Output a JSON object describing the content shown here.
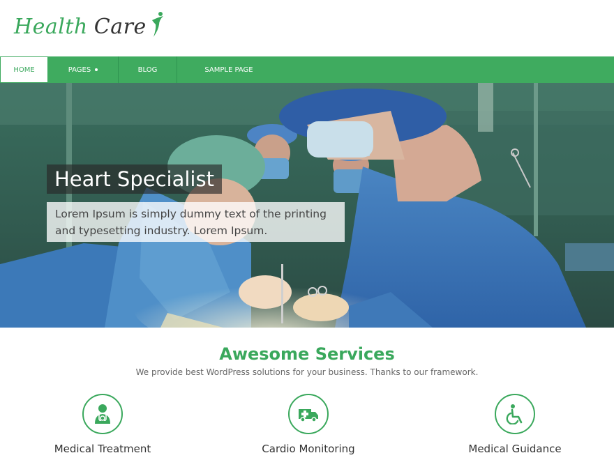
{
  "logo": {
    "word1": "Health",
    "word2": "Care"
  },
  "nav": {
    "items": [
      {
        "label": "Home"
      },
      {
        "label": "Pages"
      },
      {
        "label": "Blog"
      },
      {
        "label": "Sample Page"
      }
    ],
    "active_index": 0
  },
  "hero": {
    "title": "Heart Specialist",
    "description": "Lorem Ipsum is simply dummy text of the printing and typesetting industry. Lorem Ipsum."
  },
  "services": {
    "title": "Awesome Services",
    "subtitle": "We provide best WordPress solutions for your business. Thanks to our framework.",
    "items": [
      {
        "label": "Medical Treatment",
        "icon": "doctor-icon"
      },
      {
        "label": "Cardio Monitoring",
        "icon": "ambulance-icon"
      },
      {
        "label": "Medical Guidance",
        "icon": "wheelchair-icon"
      }
    ]
  },
  "colors": {
    "accent": "#3fab5f",
    "dark": "#333333"
  }
}
